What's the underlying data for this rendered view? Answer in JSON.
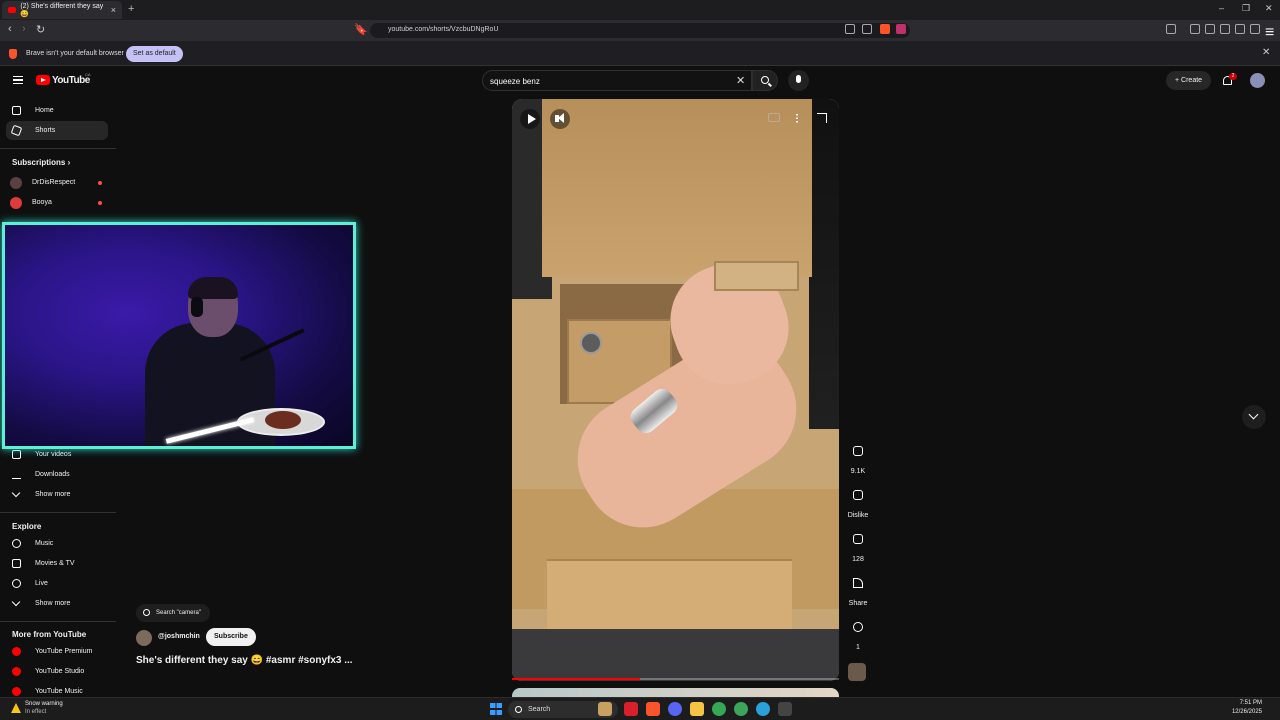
{
  "browser": {
    "tab_title": "(2) She's different they say 😄",
    "url": "youtube.com/shorts/VzcbuDNgRoU",
    "notice_text": "Brave isn't your default browser",
    "set_default_label": "Set as default"
  },
  "header": {
    "logo_text": "YouTube",
    "logo_country": "CA",
    "search_query": "squeeze benz",
    "create_label": "Create",
    "notification_count": "2"
  },
  "sidebar": {
    "home": "Home",
    "shorts": "Shorts",
    "subscriptions_heading": "Subscriptions",
    "subscriptions": [
      {
        "label": "DrDisRespect",
        "live": true
      },
      {
        "label": "Booya",
        "live": true
      }
    ],
    "you_items": [
      "Your videos",
      "Downloads",
      "Show more"
    ],
    "explore_heading": "Explore",
    "explore_items": [
      "Music",
      "Movies & TV",
      "Live",
      "Show more"
    ],
    "more_heading": "More from YouTube",
    "more_items": [
      "YouTube Premium",
      "YouTube Studio",
      "YouTube Music"
    ]
  },
  "short": {
    "search_chip": "Search \"camera\"",
    "channel": "@joshmchin",
    "subscribe_label": "Subscribe",
    "title": "She's different they say 😄 #asmr #sonyfx3 ...",
    "progress": 0.39,
    "actions": {
      "likes": "9.1K",
      "dislike": "Dislike",
      "comments": "128",
      "share": "Share",
      "remix": "1"
    }
  },
  "taskbar": {
    "weather_title": "Snow warning",
    "weather_sub": "In effect",
    "search_label": "Search",
    "time": "7:51 PM",
    "date": "12/26/2025"
  }
}
